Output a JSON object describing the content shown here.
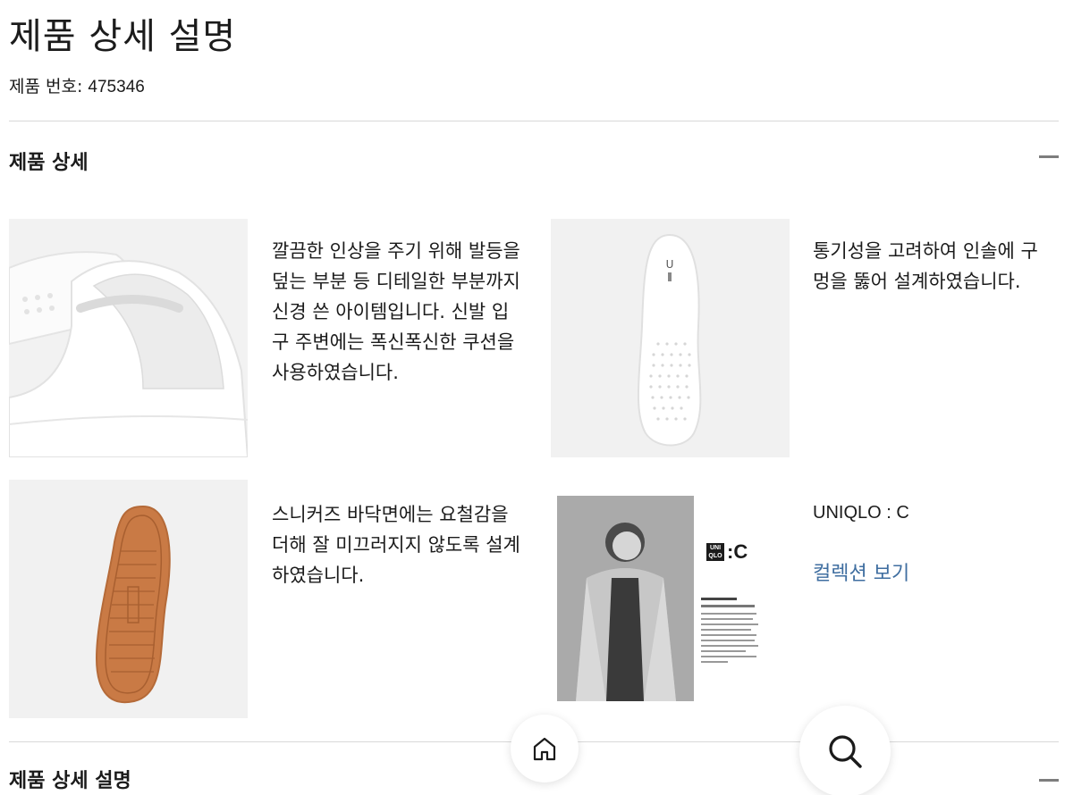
{
  "page": {
    "title": "제품 상세 설명",
    "product_number_label": "제품 번호:",
    "product_number": "475346"
  },
  "details_section": {
    "title": "제품 상세",
    "collapse_icon": "minus-icon",
    "features": [
      {
        "image": "sneaker-heel-collar-photo",
        "text": "깔끔한 인상을 주기 위해 발등을 덮는 부분 등 디테일한 부분까지 신경 쓴 아이템입니다. 신발 입구 주변에는 폭신폭신한 쿠션을 사용하였습니다."
      },
      {
        "image": "perforated-insole-photo",
        "text": "통기성을 고려하여 인솔에 구멍을 뚫어 설계하였습니다."
      },
      {
        "image": "gum-outsole-photo",
        "text": "스니커즈 바닥면에는 요철감을 더해 잘 미끄러지지 않도록 설계하였습니다."
      }
    ],
    "collaboration": {
      "image": "uniqlo-c-designer-photo",
      "logo_letters": "UNI QLO",
      "logo_suffix": ":C",
      "name": "UNIQLO : C",
      "link_label": "컬렉션 보기"
    }
  },
  "description_section": {
    "title": "제품 상세 설명",
    "collapse_icon": "minus-icon"
  },
  "floating_buttons": {
    "home_icon": "home-icon",
    "search_icon": "search-icon"
  },
  "colors": {
    "text": "#1b1b1b",
    "link": "#3f6ea0",
    "divider": "#d8d8d8",
    "icon_grey": "#7d7d7d",
    "outsole_gum": "#c97a45"
  }
}
